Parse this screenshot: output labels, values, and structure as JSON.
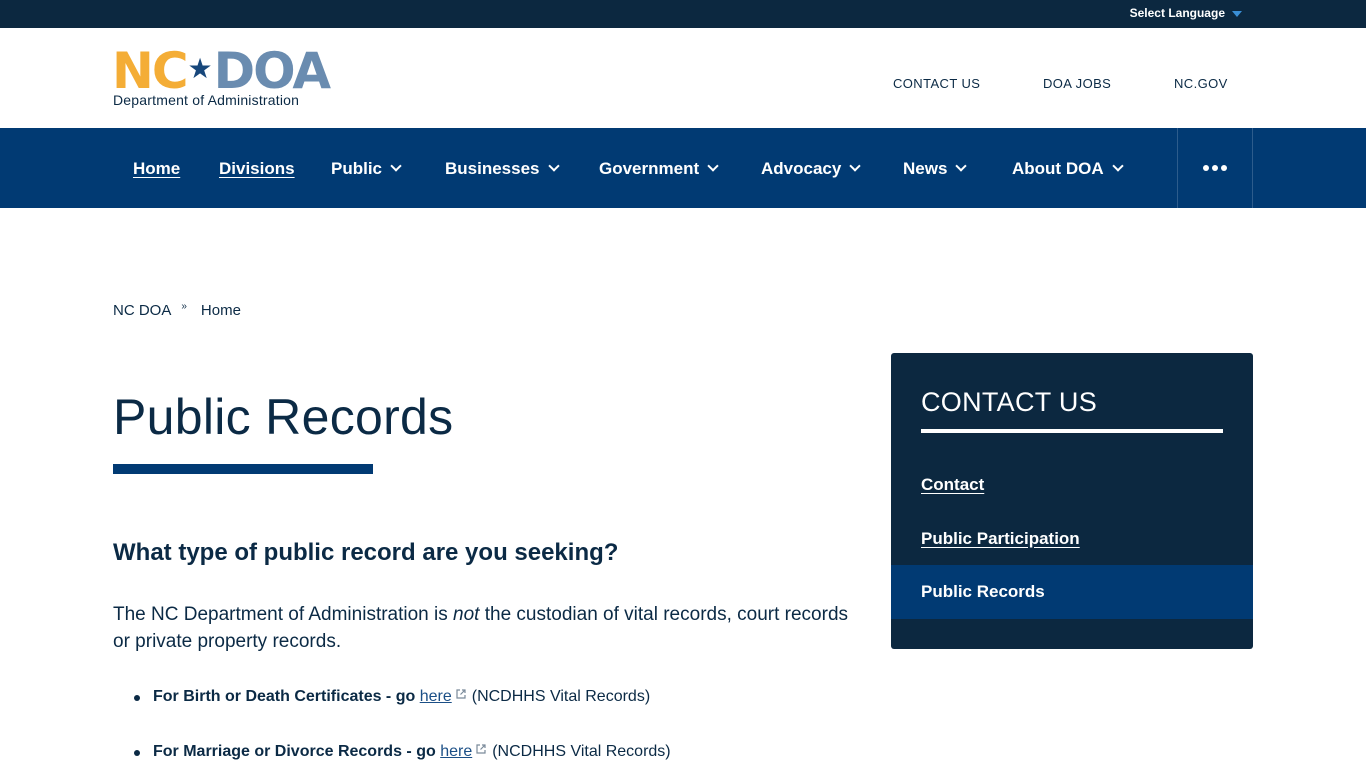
{
  "utility": {
    "language_label": "Select Language"
  },
  "header": {
    "logo": {
      "nc": "NC",
      "star": "★",
      "doa": "DOA",
      "subtitle": "Department of Administration"
    },
    "links": [
      "CONTACT US",
      "DOA JOBS",
      "NC.GOV"
    ]
  },
  "nav": {
    "items": [
      {
        "label": "Home",
        "dropdown": false
      },
      {
        "label": "Divisions",
        "dropdown": false
      },
      {
        "label": "Public",
        "dropdown": true
      },
      {
        "label": "Businesses",
        "dropdown": true
      },
      {
        "label": "Government",
        "dropdown": true
      },
      {
        "label": "Advocacy",
        "dropdown": true
      },
      {
        "label": "News",
        "dropdown": true
      },
      {
        "label": "About DOA",
        "dropdown": true
      }
    ],
    "more_icon": "ellipsis-icon"
  },
  "breadcrumb": {
    "items": [
      "NC DOA",
      "Home"
    ],
    "separator": "»"
  },
  "content": {
    "title": "Public Records",
    "subheading": "What type of public record are you seeking?",
    "intro_before": "The NC Department of Administration is ",
    "intro_emphasis": "not",
    "intro_after": " the custodian of vital records, court records or private property records.",
    "bullets": [
      {
        "strong": "For Birth or Death Certificates - go",
        "link": "here",
        "suffix": "(NCDHHS Vital Records)"
      },
      {
        "strong": "For Marriage or Divorce Records - go",
        "link": "here",
        "suffix": "(NCDHHS Vital Records)"
      }
    ]
  },
  "sidebar": {
    "title": "CONTACT US",
    "links": [
      {
        "label": "Contact",
        "active": false
      },
      {
        "label": "Public Participation",
        "active": false
      },
      {
        "label": "Public Records",
        "active": true
      }
    ]
  },
  "colors": {
    "navy_dark": "#0c2840",
    "navy": "#013a73",
    "logo_gold": "#f4ad36",
    "logo_blue": "#6a8cb0"
  }
}
